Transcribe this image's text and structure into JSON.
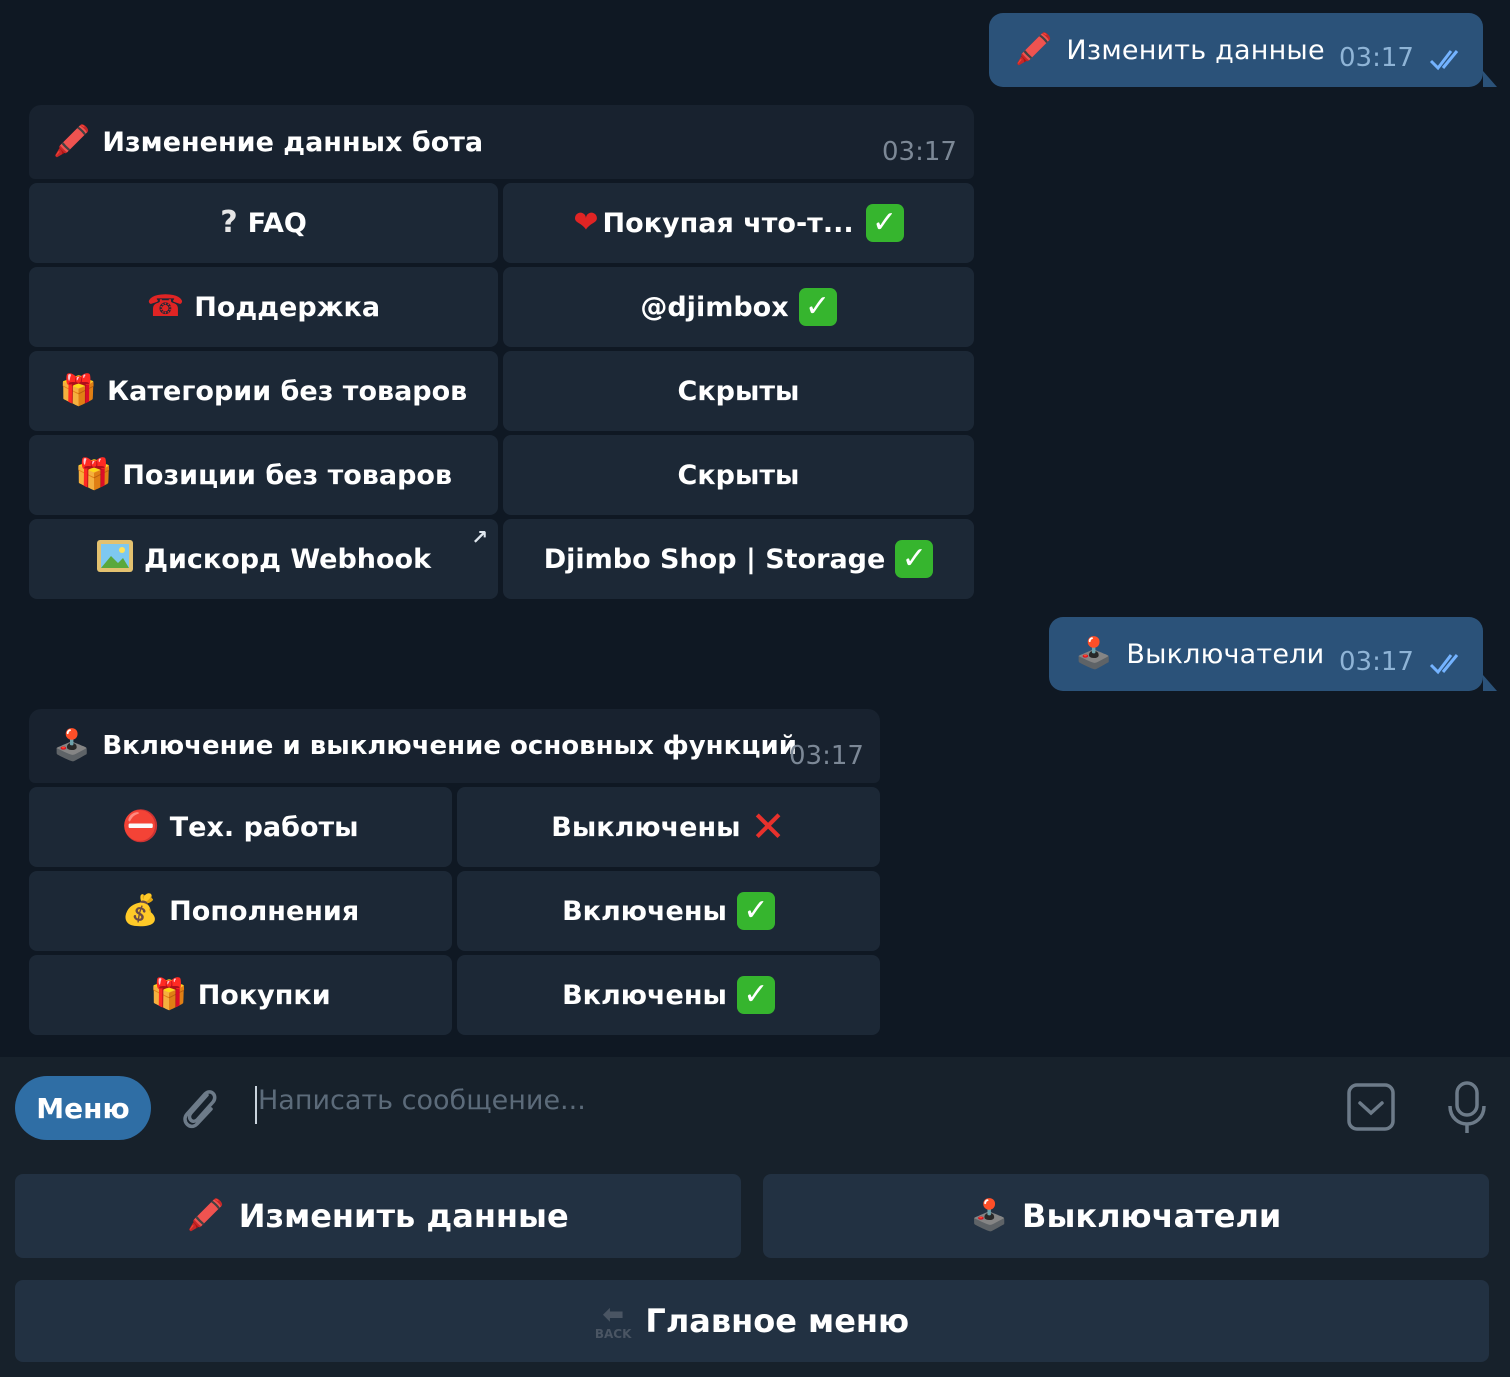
{
  "messages": {
    "outgoing_1": {
      "text": "Изменить данные",
      "time": "03:17",
      "icon": "crayon-icon"
    },
    "bot_1": {
      "title": "Изменение данных бота",
      "time": "03:17",
      "icon": "crayon-icon",
      "buttons": [
        {
          "label": "FAQ",
          "icon": "question-icon",
          "value": "Покупая что-т...",
          "value_icon": "heart-icon",
          "status": "check"
        },
        {
          "label": "Поддержка",
          "icon": "telephone-icon",
          "value": "@djimbox",
          "status": "check"
        },
        {
          "label": "Категории без товаров",
          "icon": "gift-icon",
          "value": "Скрыты"
        },
        {
          "label": "Позиции без товаров",
          "icon": "gift-icon",
          "value": "Скрыты"
        },
        {
          "label": "Дискорд Webhook",
          "icon": "picture-icon",
          "value": "Djimbo Shop | Storage",
          "status": "check"
        }
      ]
    },
    "outgoing_2": {
      "text": "Выключатели",
      "time": "03:17",
      "icon": "joystick-icon"
    },
    "bot_2": {
      "title": "Включение и выключение основных функций",
      "time": "03:17",
      "icon": "joystick-icon",
      "buttons": [
        {
          "label": "Тех. работы",
          "icon": "no-entry-icon",
          "value": "Выключены",
          "status": "cross"
        },
        {
          "label": "Пополнения",
          "icon": "money-bag-icon",
          "value": "Включены",
          "status": "check"
        },
        {
          "label": "Покупки",
          "icon": "gift-icon",
          "value": "Включены",
          "status": "check"
        }
      ]
    }
  },
  "composer": {
    "menu_label": "Меню",
    "placeholder": "Написать сообщение..."
  },
  "keyboard": {
    "edit_label": "Изменить данные",
    "switches_label": "Выключатели",
    "main_menu_label": "Главное меню",
    "back_badge": "BACK"
  },
  "colors": {
    "background": "#0f1823",
    "outgoing_bubble": "#2b5279",
    "button": "#1c2836",
    "accent": "#2f6ea5",
    "check_green": "#36b52e",
    "cross_red": "#e8312c"
  }
}
